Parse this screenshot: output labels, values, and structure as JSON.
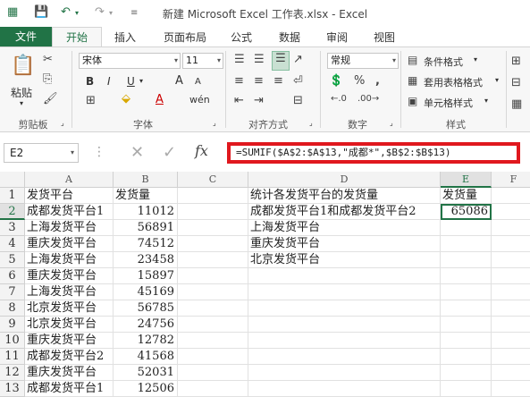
{
  "window": {
    "title": "新建 Microsoft Excel 工作表.xlsx - Excel"
  },
  "quick_access": {
    "save_icon": "save-icon",
    "undo_icon": "undo-icon",
    "redo_icon": "redo-icon"
  },
  "tabs": [
    "文件",
    "开始",
    "插入",
    "页面布局",
    "公式",
    "数据",
    "审阅",
    "视图"
  ],
  "ribbon": {
    "clipboard": {
      "paste": "粘贴",
      "label": "剪贴板"
    },
    "font": {
      "name": "宋体",
      "size": "11",
      "label": "字体",
      "bold": "B",
      "italic": "I",
      "underline": "U",
      "grow": "A",
      "shrink": "A",
      "color_a": "A",
      "wen": "wén"
    },
    "alignment": {
      "label": "对齐方式"
    },
    "number": {
      "format": "常规",
      "label": "数字"
    },
    "styles": {
      "conditional": "条件格式",
      "table": "套用表格格式",
      "cell": "单元格样式",
      "label": "样式"
    }
  },
  "formula_bar": {
    "name_box": "E2",
    "formula": "=SUMIF($A$2:$A$13,\"成都*\",$B$2:$B$13)",
    "fx": "fx"
  },
  "sheet": {
    "columns": [
      "A",
      "B",
      "C",
      "D",
      "E",
      "F"
    ],
    "rows": [
      "1",
      "2",
      "3",
      "4",
      "5",
      "6",
      "7",
      "8",
      "9",
      "10",
      "11",
      "12",
      "13"
    ],
    "A": [
      "发货平台",
      "成都发货平台1",
      "上海发货平台",
      "重庆发货平台",
      "上海发货平台",
      "重庆发货平台",
      "上海发货平台",
      "北京发货平台",
      "北京发货平台",
      "重庆发货平台",
      "成都发货平台2",
      "重庆发货平台",
      "成都发货平台1"
    ],
    "B": [
      "发货量",
      "11012",
      "56891",
      "74512",
      "23458",
      "15897",
      "45169",
      "56785",
      "24756",
      "12782",
      "41568",
      "52031",
      "12506"
    ],
    "D": [
      "统计各发货平台的发货量",
      "成都发货平台1和成都发货平台2",
      "上海发货平台",
      "重庆发货平台",
      "北京发货平台"
    ],
    "E": [
      "发货量",
      "65086"
    ]
  },
  "colors": {
    "accent": "#217346",
    "highlight": "#e0181e"
  }
}
